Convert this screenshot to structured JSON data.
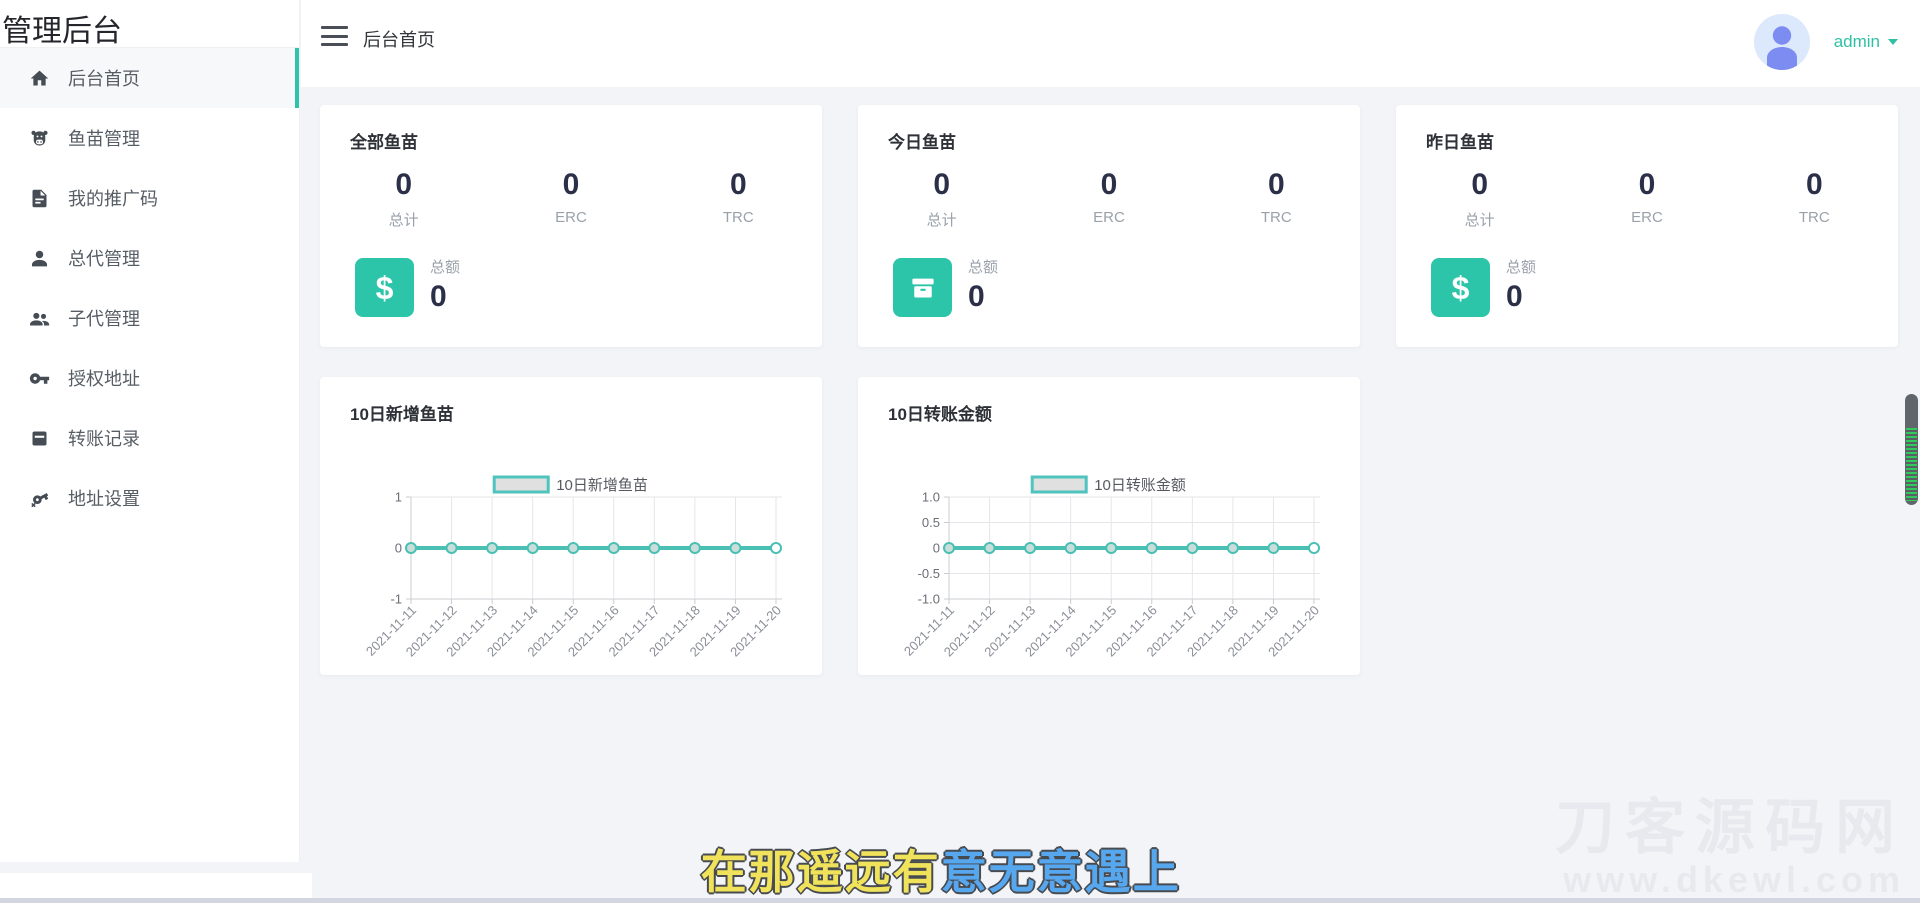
{
  "app": {
    "title": "管理后台"
  },
  "sidebar": {
    "items": [
      {
        "label": "后台首页",
        "icon": "home-icon",
        "active": true
      },
      {
        "label": "鱼苗管理",
        "icon": "cow-icon",
        "active": false
      },
      {
        "label": "我的推广码",
        "icon": "document-icon",
        "active": false
      },
      {
        "label": "总代管理",
        "icon": "person-icon",
        "active": false
      },
      {
        "label": "子代管理",
        "icon": "people-icon",
        "active": false
      },
      {
        "label": "授权地址",
        "icon": "key-icon",
        "active": false
      },
      {
        "label": "转账记录",
        "icon": "records-icon",
        "active": false
      },
      {
        "label": "地址设置",
        "icon": "key-settings-icon",
        "active": false
      }
    ]
  },
  "header": {
    "breadcrumb": "后台首页",
    "username": "admin"
  },
  "stat_cards": [
    {
      "title": "全部鱼苗",
      "columns": [
        {
          "value": "0",
          "label": "总计"
        },
        {
          "value": "0",
          "label": "ERC"
        },
        {
          "value": "0",
          "label": "TRC"
        }
      ],
      "total": {
        "label": "总额",
        "value": "0"
      },
      "icon": "dollar-icon"
    },
    {
      "title": "今日鱼苗",
      "columns": [
        {
          "value": "0",
          "label": "总计"
        },
        {
          "value": "0",
          "label": "ERC"
        },
        {
          "value": "0",
          "label": "TRC"
        }
      ],
      "total": {
        "label": "总额",
        "value": "0"
      },
      "icon": "archive-icon"
    },
    {
      "title": "昨日鱼苗",
      "columns": [
        {
          "value": "0",
          "label": "总计"
        },
        {
          "value": "0",
          "label": "ERC"
        },
        {
          "value": "0",
          "label": "TRC"
        }
      ],
      "total": {
        "label": "总额",
        "value": "0"
      },
      "icon": "dollar-icon"
    }
  ],
  "chart_data": [
    {
      "type": "line",
      "title": "10日新增鱼苗",
      "legend": [
        "10日新增鱼苗"
      ],
      "legend_position": "top-center",
      "categories": [
        "2021-11-11",
        "2021-11-12",
        "2021-11-13",
        "2021-11-14",
        "2021-11-15",
        "2021-11-16",
        "2021-11-17",
        "2021-11-18",
        "2021-11-19",
        "2021-11-20"
      ],
      "series": [
        {
          "name": "10日新增鱼苗",
          "values": [
            0,
            0,
            0,
            0,
            0,
            0,
            0,
            0,
            0,
            0
          ]
        }
      ],
      "ylim": [
        -1,
        1
      ],
      "ytick_values": [
        1,
        0,
        -1
      ],
      "ytick_labels": [
        "1",
        "0",
        "-1"
      ],
      "grid": true,
      "line_color": "#49c0b3"
    },
    {
      "type": "line",
      "title": "10日转账金额",
      "legend": [
        "10日转账金额"
      ],
      "legend_position": "top-center",
      "categories": [
        "2021-11-11",
        "2021-11-12",
        "2021-11-13",
        "2021-11-14",
        "2021-11-15",
        "2021-11-16",
        "2021-11-17",
        "2021-11-18",
        "2021-11-19",
        "2021-11-20"
      ],
      "series": [
        {
          "name": "10日转账金额",
          "values": [
            0,
            0,
            0,
            0,
            0,
            0,
            0,
            0,
            0,
            0
          ]
        }
      ],
      "ylim": [
        -1,
        1
      ],
      "ytick_values": [
        1,
        0.5,
        0,
        -0.5,
        -1
      ],
      "ytick_labels": [
        "1.0",
        "0.5",
        "0",
        "-0.5",
        "-1.0"
      ],
      "grid": true,
      "line_color": "#49c0b3"
    }
  ],
  "overlay": {
    "subtitle": {
      "text": "在那遥远有意无意遇上",
      "highlight_text": "在那遥远有",
      "rest_text": "意无意遇上",
      "highlight_color": "#f0e25a",
      "rest_color": "#57a7ef"
    },
    "watermark": {
      "line1": "刀客源码网",
      "line2": "www.dkewl.com"
    }
  },
  "colors": {
    "accent_teal": "#2dc5a9",
    "chart_line": "#49c0b3",
    "username_text": "#2fc0a4",
    "stat_number": "#2b3048",
    "content_bg": "#f3f4f8"
  }
}
